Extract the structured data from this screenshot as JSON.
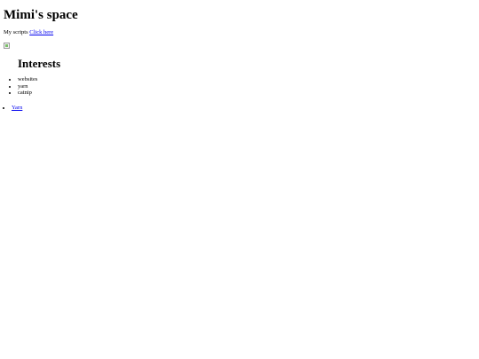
{
  "page": {
    "title": "Mimi's space"
  },
  "scripts": {
    "label": "My scripts",
    "link_text": "Click here"
  },
  "interests": {
    "heading": "Interests",
    "items": [
      "websites",
      "yarn",
      "catnip"
    ]
  },
  "links": {
    "items": [
      "Yarn"
    ]
  },
  "colors": {
    "link": "#0000ee",
    "text": "#000000",
    "background": "#ffffff"
  },
  "icons": {
    "profile_image": "broken-image-icon"
  }
}
